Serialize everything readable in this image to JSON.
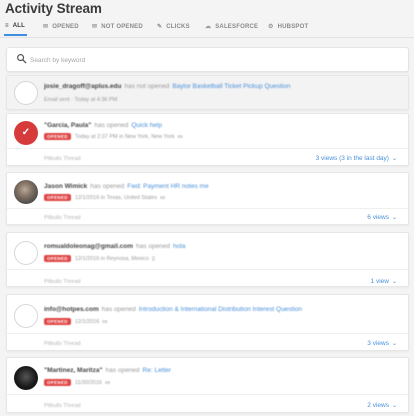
{
  "page": {
    "title": "Activity Stream"
  },
  "tabs": [
    {
      "label": "ALL",
      "icon": "list-icon",
      "glyph": "≡",
      "active": true
    },
    {
      "label": "OPENED",
      "icon": "opened-icon",
      "glyph": "✉",
      "active": false
    },
    {
      "label": "NOT OPENED",
      "icon": "not-opened-icon",
      "glyph": "✉",
      "active": false
    },
    {
      "label": "CLICKS",
      "icon": "link-icon",
      "glyph": "✎",
      "active": false
    },
    {
      "label": "SALESFORCE",
      "icon": "salesforce-icon",
      "glyph": "☁",
      "active": false
    },
    {
      "label": "HUBSPOT",
      "icon": "hubspot-icon",
      "glyph": "⚙",
      "active": false
    }
  ],
  "search": {
    "placeholder": "Search by keyword",
    "value": ""
  },
  "activities": [
    {
      "who": "josie_dragoff@aplus.edu",
      "verb": "has not opened",
      "doc": "Baylor Basketball Ticket Pickup Question",
      "badge": "",
      "meta": "Email sent · Today at 4:36 PM",
      "device": "",
      "thread": "",
      "views": ""
    },
    {
      "who": "\"Garcia, Paula\"",
      "verb": "has opened",
      "doc": "Quick help",
      "badge": "OPENED",
      "meta": "Today at 2:37 PM in New York, New York",
      "device": "▭",
      "thread": "Pitbulls Thread",
      "views": "3 views (3 in the last day)"
    },
    {
      "who": "Jason Wimick",
      "verb": "has opened",
      "doc": "Fwd: Payment HR notes me",
      "badge": "OPENED",
      "meta": "12/1/2016 in Texas, United States",
      "device": "▭",
      "thread": "Pitbulls Thread",
      "views": "6 views"
    },
    {
      "who": "romualdoleonag@gmail.com",
      "verb": "has opened",
      "doc": "hola",
      "badge": "OPENED",
      "meta": "12/1/2016 in Reynosa, Mexico",
      "device": "▯",
      "thread": "Pitbulls Thread",
      "views": "1 view"
    },
    {
      "who": "info@hotpes.com",
      "verb": "has opened",
      "doc": "Introduction & International Distribution Interest Question",
      "badge": "OPENED",
      "meta": "12/1/2016",
      "device": "▭",
      "thread": "Pitbulls Thread",
      "views": "3 views"
    },
    {
      "who": "\"Martinez, Maritza\"",
      "verb": "has opened",
      "doc": "Re: Letter",
      "badge": "OPENED",
      "meta": "11/30/2016",
      "device": "▭",
      "thread": "Pitbulls Thread",
      "views": "2 views"
    }
  ]
}
